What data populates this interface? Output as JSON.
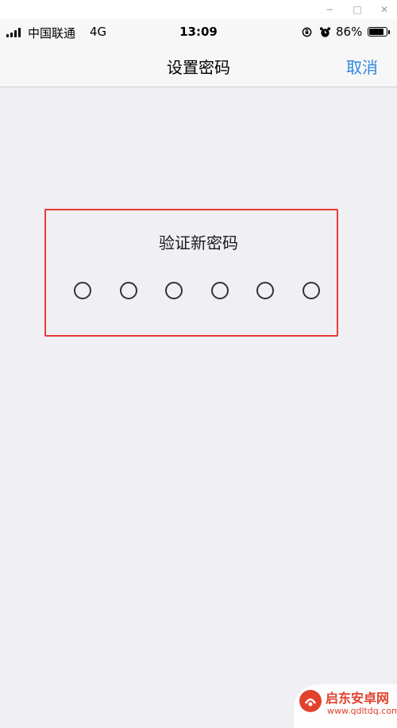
{
  "window_controls": {
    "minimize": "−",
    "maximize": "□",
    "close": "✕"
  },
  "status_bar": {
    "carrier": "中国联通",
    "network": "4G",
    "time": "13:09",
    "battery_percent_label": "86%",
    "battery_level": 0.86,
    "icons": [
      "signal-icon",
      "orientation-lock-icon",
      "alarm-icon",
      "battery-icon"
    ]
  },
  "nav": {
    "title": "设置密码",
    "cancel_label": "取消"
  },
  "passcode": {
    "prompt": "验证新密码",
    "digits_total": 6,
    "digits_entered": 0
  },
  "watermark": {
    "name": "启东安卓网",
    "url": "www.qdltdq.com"
  },
  "colors": {
    "accent": "#2f86e1",
    "highlight_border": "#e53b35",
    "background": "#efeff4"
  }
}
